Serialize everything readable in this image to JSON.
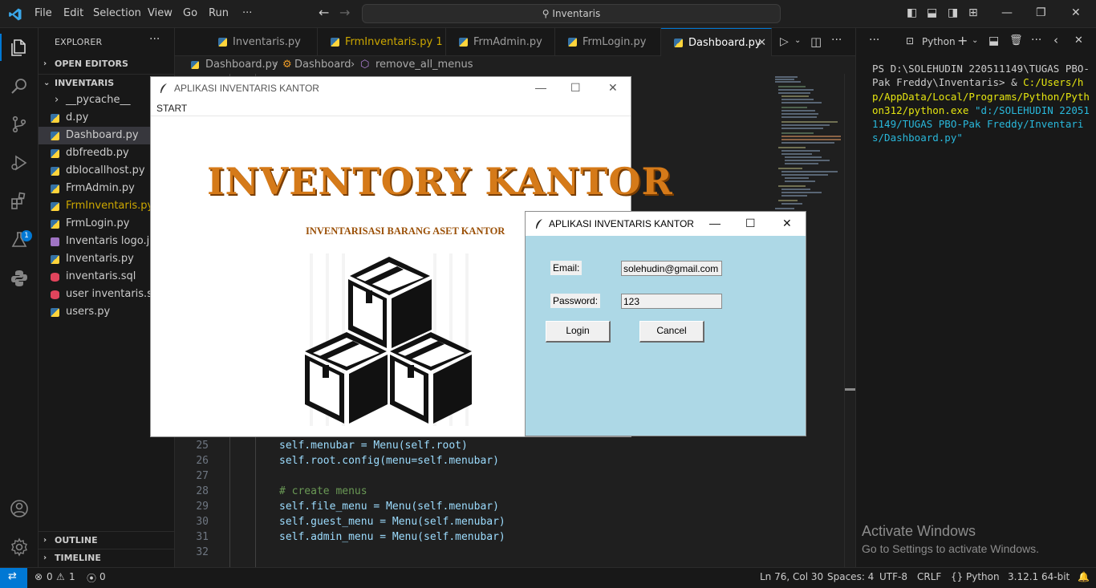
{
  "titlebar": {
    "menus": [
      "File",
      "Edit",
      "Selection",
      "View",
      "Go",
      "Run",
      "···"
    ],
    "search": "Inventaris"
  },
  "explorer": {
    "header": "EXPLORER",
    "open_editors": "OPEN EDITORS",
    "folder": "INVENTARIS",
    "files": [
      {
        "name": "__pycache__",
        "type": "folder"
      },
      {
        "name": "d.py",
        "type": "py"
      },
      {
        "name": "Dashboard.py",
        "type": "py",
        "active": true
      },
      {
        "name": "dbfreedb.py",
        "type": "py"
      },
      {
        "name": "dblocallhost.py",
        "type": "py"
      },
      {
        "name": "FrmAdmin.py",
        "type": "py"
      },
      {
        "name": "FrmInventaris.py",
        "type": "py",
        "modified": true
      },
      {
        "name": "FrmLogin.py",
        "type": "py"
      },
      {
        "name": "Inventaris logo.jpg",
        "type": "img"
      },
      {
        "name": "Inventaris.py",
        "type": "py"
      },
      {
        "name": "inventaris.sql",
        "type": "sql"
      },
      {
        "name": "user inventaris.sql",
        "type": "sql"
      },
      {
        "name": "users.py",
        "type": "py"
      }
    ],
    "outline": "OUTLINE",
    "timeline": "TIMELINE",
    "extensions_badge": "1"
  },
  "tabs": [
    {
      "label": "Inventaris.py"
    },
    {
      "label": "FrmInventaris.py",
      "suffix": "1"
    },
    {
      "label": "FrmAdmin.py"
    },
    {
      "label": "FrmLogin.py"
    },
    {
      "label": "Dashboard.py",
      "active": true
    }
  ],
  "breadcrumb": {
    "file": "Dashboard.py",
    "cls": "Dashboard",
    "method": "remove_all_menus"
  },
  "code_lines": [
    {
      "n": "25",
      "text": "self.menubar = Menu(self.root)"
    },
    {
      "n": "26",
      "text": "self.root.config(menu=self.menubar)"
    },
    {
      "n": "27",
      "text": ""
    },
    {
      "n": "28",
      "text": "# create menus"
    },
    {
      "n": "29",
      "text": "self.file_menu = Menu(self.menubar)"
    },
    {
      "n": "30",
      "text": "self.guest_menu = Menu(self.menubar)"
    },
    {
      "n": "31",
      "text": "self.admin_menu = Menu(self.menubar)"
    },
    {
      "n": "32",
      "text": ""
    }
  ],
  "terminal": {
    "tab_label": "Python",
    "prompt": "PS D:\\SOLEHUDIN 220511149\\TUGAS PBO-Pak Freddy\\Inventaris> & ",
    "exe": "C:/Users/hp/AppData/Local/Programs/Python/Python312/python.exe",
    "script": "\"d:/SOLEHUDIN 220511149/TUGAS PBO-Pak Freddy/Inventaris/Dashboard.py\"",
    "activate_title": "Activate Windows",
    "activate_sub": "Go to Settings to activate Windows."
  },
  "statusbar": {
    "errors": "0",
    "warnings": "1",
    "ports": "0",
    "position": "Ln 76, Col 30",
    "spaces": "Spaces: 4",
    "encoding": "UTF-8",
    "eol": "CRLF",
    "language": "Python",
    "interpreter": "3.12.1 64-bit"
  },
  "dashboard_window": {
    "title": "APLIKASI INVENTARIS KANTOR",
    "menu": "START",
    "heading": "INVENTORY KANTOR",
    "subheading": "INVENTARISASI BARANG ASET KANTOR"
  },
  "login_window": {
    "title": "APLIKASI INVENTARIS KANTOR",
    "email_label": "Email:",
    "email_value": "solehudin@gmail.com",
    "password_label": "Password:",
    "password_value": "123",
    "login_button": "Login",
    "cancel_button": "Cancel",
    "background": "#add8e6"
  }
}
